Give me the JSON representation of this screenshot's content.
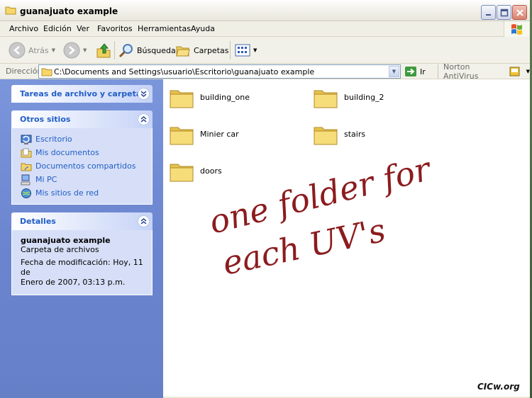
{
  "window": {
    "title": "guanajuato example"
  },
  "menu": [
    "Archivo",
    "Edición",
    "Ver",
    "Favoritos",
    "Herramientas",
    "Ayuda"
  ],
  "toolbar": {
    "back": "Atrás",
    "search": "Búsqueda",
    "folders": "Carpetas"
  },
  "address": {
    "label": "Dirección",
    "path": "C:\\Documents and Settings\\usuario\\Escritorio\\guanajuato example",
    "go": "Ir",
    "antivirus": "Norton AntiVirus"
  },
  "panels": {
    "tasks": {
      "title": "Tareas de archivo y carpeta"
    },
    "places": {
      "title": "Otros sitios",
      "items": [
        {
          "label": "Escritorio",
          "icon": "desktop-icon"
        },
        {
          "label": "Mis documentos",
          "icon": "documents-folder-icon"
        },
        {
          "label": "Documentos compartidos",
          "icon": "shared-folder-icon"
        },
        {
          "label": "Mi PC",
          "icon": "computer-icon"
        },
        {
          "label": "Mis sitios de red",
          "icon": "network-icon"
        }
      ]
    },
    "details": {
      "title": "Detalles",
      "name": "guanajuato example",
      "type": "Carpeta de archivos",
      "modified_1": "Fecha de modificación: Hoy, 11 de",
      "modified_2": "Enero de 2007, 03:13 p.m."
    }
  },
  "folders": [
    "building_one",
    "building_2",
    "Minier car",
    "stairs",
    "doors"
  ],
  "annotation": {
    "line1": "one folder for",
    "line2": "each UV's",
    "color": "#8b1c1f"
  },
  "watermark": "CICw.org",
  "colors": {
    "link": "#215dc6",
    "pane": "#7b96db",
    "annotation": "#8b1c1f"
  }
}
